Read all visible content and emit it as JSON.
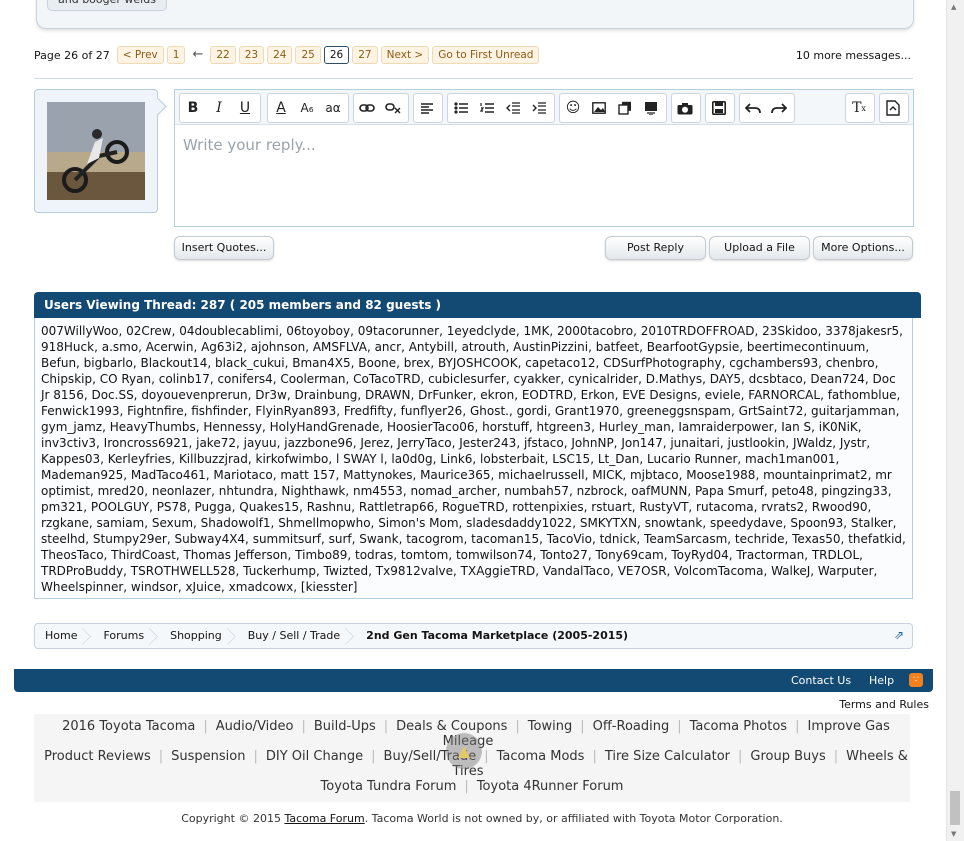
{
  "prev_post": {
    "chip": "and booger welds"
  },
  "pagenav": {
    "label": "Page 26 of 27",
    "prev": "< Prev",
    "first": "1",
    "ellipsis": "←",
    "pages": [
      "22",
      "23",
      "24",
      "25",
      "26",
      "27"
    ],
    "current": "26",
    "next": "Next >",
    "first_unread": "Go to First Unread",
    "more_messages": "10 more messages..."
  },
  "editor": {
    "placeholder": "Write your reply...",
    "toolbar_icons": [
      "bold-icon",
      "italic-icon",
      "underline-icon",
      "font-color-icon",
      "font-size-icon",
      "font-family-icon",
      "link-icon",
      "unlink-icon",
      "align-icon",
      "bullet-list-icon",
      "numbered-list-icon",
      "outdent-icon",
      "indent-icon",
      "smilies-icon",
      "image-icon",
      "media-icon",
      "insert-icon",
      "camera-icon",
      "save-draft-icon",
      "undo-icon",
      "redo-icon",
      "remove-format-icon",
      "toggle-bbcode-icon"
    ]
  },
  "buttons": {
    "insert_quotes": "Insert Quotes...",
    "post_reply": "Post Reply",
    "upload_file": "Upload a File",
    "more_options": "More Options..."
  },
  "viewers": {
    "header": "Users Viewing Thread: 287 ( 205 members and 82 guests )",
    "list": "007WillyWoo, 02Crew, 04doublecablimi, 06toyoboy, 09tacorunner, 1eyedclyde, 1MK, 2000tacobro, 2010TRDOFFROAD, 23Skidoo, 3378jakesr5, 918Huck, a.smo, Acerwin, Ag63i2, ajohnson, AMSFLVA, ancr, Antybill, atrouth, AustinPizzini, batfeet, BearfootGypsie, beertimecontinuum, Befun, bigbarlo, Blackout14, black_cukui, Bman4X5, Boone, brex, BYJOSHCOOK, capetaco12, CDSurfPhotography, cgchambers93, chenbro, Chipskip, CO Ryan, colinb17, conifers4, Coolerman, CoTacoTRD, cubiclesurfer, cyakker, cynicalrider, D.Mathys, DAY5, dcsbtaco, Dean724, Doc Jr 8156, Doc.SS, doyouevenprerun, Dr3w, Drainbung, DRAWN, DrFunker, ekron, EODTRD, Erkon, EVE Designs, eviele, FARNORCAL, fathomblue, Fenwick1993, Fightnfire, fishfinder, FlyinRyan893, Fredfifty, funflyer26, Ghost., gordi, Grant1970, greeneggsnspam, GrtSaint72, guitarjamman, gym_jamz, HeavyThumbs, Hennessy, HolyHandGrenade, HoosierTaco06, horstuff, htgreen3, Hurley_man, Iamraiderpower, Ian S, iK0NiK, inv3ctiv3, Ironcross6921, jake72, jayuu, jazzbone96, Jerez, JerryTaco, Jester243, jfstaco, JohnNP, Jon147, junaitari, justlookin, JWaldz, Jystr, Kappes03, Kerleyfries, Killbuzzjrad, kirkofwimbo, l SWAY l, la0d0g, Link6, lobsterbait, LSC15, Lt_Dan, Lucario Runner, mach1man001, Mademan925, MadTaco461, Mariotaco, matt 157, Mattynokes, Maurice365, michaelrussell, MICK, mjbtaco, Moose1988, mountainprimat2, mr optimist, mred20, neonlazer, nhtundra, Nighthawk, nm4553, nomad_archer, numbah57, nzbrock, oafMUNN, Papa Smurf, peto48, pingzing33, pm321, POOLGUY, PS78, Pugga, Quakes15, Rashnu, Rattletrap66, RogueTRD, rottenpixies, rstuart, RustyVT, rutacoma, rvrats2, Rwood90, rzgkane, samiam, Sexum, Shadowolf1, Shmellmopwho, Simon's Mom, sladesdaddy1022, SMKYTXN, snowtank, speedydave, Spoon93, Stalker, steelhd, Stumpy29er, Subway4X4, summitsurf, surf, Swank, tacogrom, tacoman15, TacoVio, tdnick, TeamSarcasm, techride, Texas50, thefatkid, TheosTaco, ThirdCoast, Thomas Jefferson, Timbo89, todras, tomtom, tomwilson74, Tonto27, Tony69cam, ToyRyd04, Tractorman, TRDLOL, TRDProBuddy, TSROTHWELL528, Tuckerhump, Twizted, Tx9812valve, TXAggieTRD, VandalTaco, VE7OSR, VolcomTacoma, WalkeJ, Warputer, Wheelspinner, windsor, xJuice, xmadcowx, [kiesster]"
  },
  "breadcrumb": [
    "Home",
    "Forums",
    "Shopping",
    "Buy / Sell / Trade",
    "2nd Gen Tacoma Marketplace (2005-2015)"
  ],
  "footer": {
    "contact": "Contact Us",
    "help": "Help",
    "rss_icon": "rss-icon",
    "terms": "Terms and Rules"
  },
  "seo_links": {
    "row1": [
      "2016 Toyota Tacoma",
      "Audio/Video",
      "Build-Ups",
      "Deals & Coupons",
      "Towing",
      "Off-Roading",
      "Tacoma Photos",
      "Improve Gas Mileage"
    ],
    "row2": [
      "Product Reviews",
      "Suspension",
      "DIY Oil Change",
      "Buy/Sell/Trade",
      "Tacoma Mods",
      "Tire Size Calculator",
      "Group Buys",
      "Wheels & Tires"
    ],
    "row3": [
      "Toyota Tundra Forum",
      "Toyota 4Runner Forum"
    ]
  },
  "copyright": {
    "pre": "Copyright © 2015 ",
    "link": "Tacoma Forum",
    "post": ". Tacoma World is not owned by, or affiliated with Toyota Motor Corporation."
  },
  "colors": {
    "header_bg": "#134a73",
    "page_link": "#8a5b14",
    "page_link_bg": "#fff4e3"
  }
}
